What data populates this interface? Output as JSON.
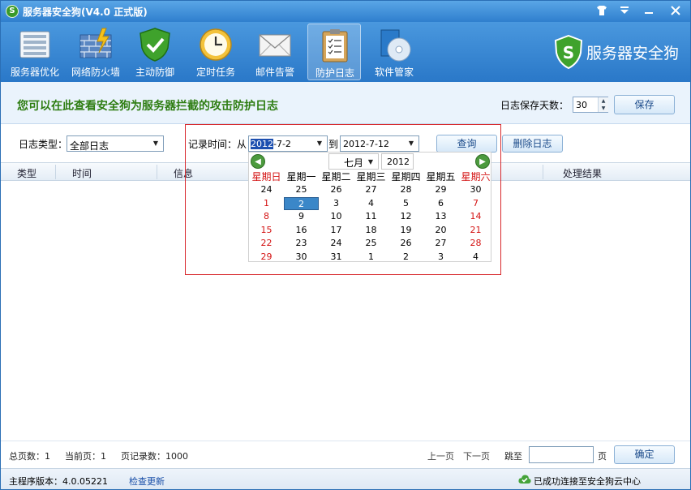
{
  "window": {
    "title": "服务器安全狗(V4.0 正式版)",
    "logo_letter": "S",
    "controls": [
      "skin-icon",
      "menu-icon",
      "minimize-icon",
      "close-icon"
    ]
  },
  "toolbar": {
    "items": [
      {
        "label": "服务器优化",
        "icon": "server-icon"
      },
      {
        "label": "网络防火墙",
        "icon": "firewall-icon"
      },
      {
        "label": "主动防御",
        "icon": "shield-icon"
      },
      {
        "label": "定时任务",
        "icon": "clock-icon"
      },
      {
        "label": "邮件告警",
        "icon": "mail-icon"
      },
      {
        "label": "防护日志",
        "icon": "clipboard-icon",
        "active": true
      },
      {
        "label": "软件管家",
        "icon": "software-disc-icon"
      }
    ],
    "brand": "服务器安全狗",
    "brand_letter": "S"
  },
  "header": {
    "title": "您可以在此查看安全狗为服务器拦截的攻击防护日志",
    "days_label": "日志保存天数：",
    "days_value": "30",
    "save_label": "保存"
  },
  "filter": {
    "logtype_label": "日志类型：",
    "logtype_value": "全部日志",
    "time_label": "记录时间：从",
    "from_selected": "2012",
    "from_rest": "-7-2",
    "to_label": "到",
    "to_value": "2012-7-12",
    "query_label": "查询",
    "delete_label": "删除日志"
  },
  "table": {
    "columns": [
      "类型",
      "时间",
      "信息",
      "处理结果"
    ]
  },
  "calendar": {
    "month": "七月",
    "year": "2012",
    "weekdays": [
      "星期日",
      "星期一",
      "星期二",
      "星期三",
      "星期四",
      "星期五",
      "星期六"
    ],
    "weeks": [
      [
        "24",
        "25",
        "26",
        "27",
        "28",
        "29",
        "30"
      ],
      [
        "1",
        "2",
        "3",
        "4",
        "5",
        "6",
        "7"
      ],
      [
        "8",
        "9",
        "10",
        "11",
        "12",
        "13",
        "14"
      ],
      [
        "15",
        "16",
        "17",
        "18",
        "19",
        "20",
        "21"
      ],
      [
        "22",
        "23",
        "24",
        "25",
        "26",
        "27",
        "28"
      ],
      [
        "29",
        "30",
        "31",
        "1",
        "2",
        "3",
        "4"
      ]
    ],
    "selected_day": "2",
    "accent_color": "#d41414"
  },
  "pager": {
    "total_pages": "总页数：1",
    "current_page": "当前页：1",
    "page_records": "页记录数：1000",
    "prev": "上一页",
    "next": "下一页",
    "jump_to": "跳至",
    "page_unit": "页",
    "jump_value": "",
    "ok_label": "确定"
  },
  "status": {
    "version": "主程序版本：4.0.05221",
    "check_update": "检查更新",
    "cloud_status": "已成功连接至安全狗云中心"
  }
}
